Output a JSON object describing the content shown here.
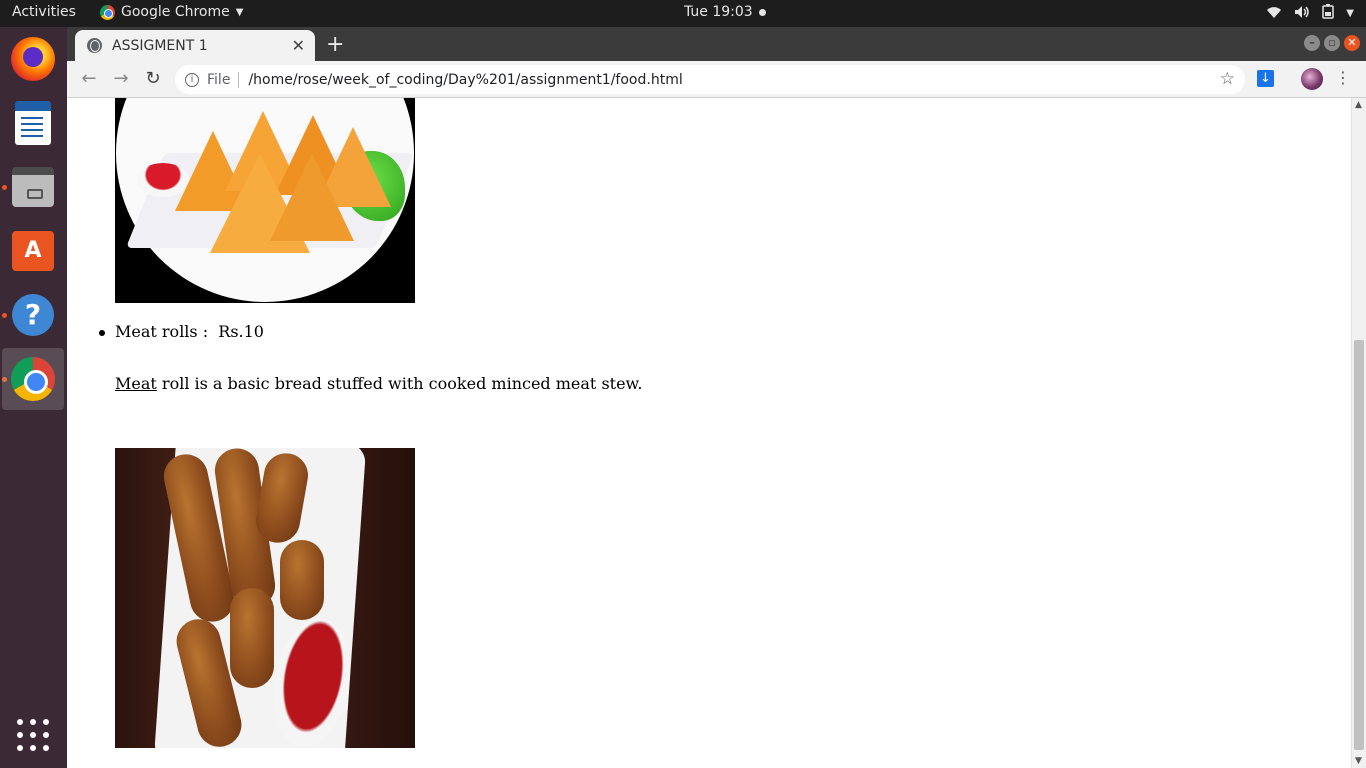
{
  "topbar": {
    "activities": "Activities",
    "app_name": "Google Chrome",
    "clock": "Tue 19:03"
  },
  "dock": {
    "items": [
      "firefox-icon",
      "libreoffice-writer-icon",
      "files-icon",
      "software-center-icon",
      "help-icon",
      "chrome-icon",
      "show-applications-icon"
    ],
    "store_glyph": "A",
    "help_glyph": "?"
  },
  "browser": {
    "tab_title": "ASSIGMENT 1",
    "tab_close": "✕",
    "new_tab": "+",
    "address": {
      "scheme_label": "File",
      "url": "/home/rose/week_of_coding/Day%201/assignment1/food.html"
    }
  },
  "page": {
    "list_item": "Meat rolls :  Rs.10",
    "paragraph_link": "Meat",
    "paragraph_rest": " roll is a basic bread stuffed with cooked minced meat stew."
  },
  "colors": {
    "accent": "#e95420",
    "dock_bg": "#3b2a35",
    "topbar_bg": "#1d1d1d"
  }
}
